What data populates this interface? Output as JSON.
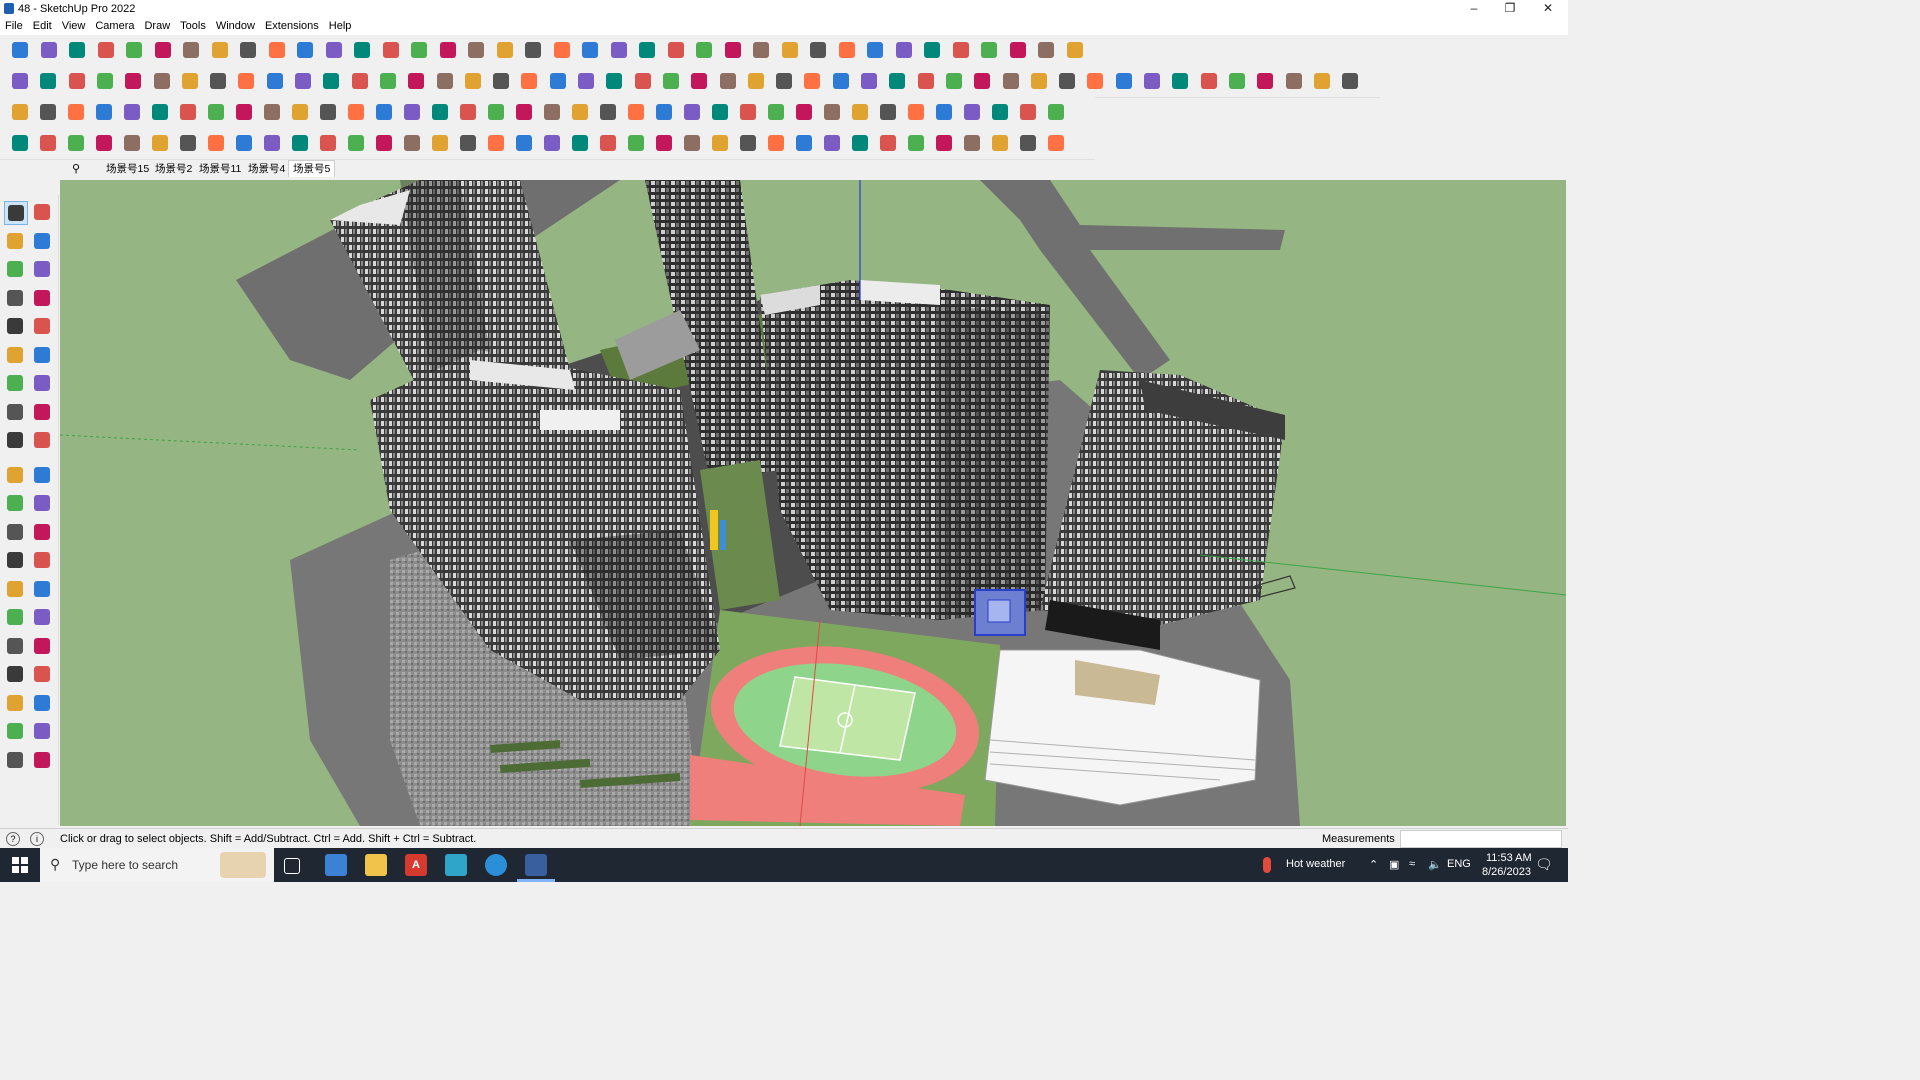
{
  "window": {
    "title": "48 - SketchUp Pro 2022",
    "minimize_icon": "minimize-icon",
    "maximize_icon": "restore-icon",
    "close_icon": "close-icon"
  },
  "menu": {
    "items": [
      "File",
      "Edit",
      "View",
      "Camera",
      "Draw",
      "Tools",
      "Window",
      "Extensions",
      "Help"
    ]
  },
  "scenes": {
    "tabs": [
      "场景号15",
      "场景号2",
      "场景号11",
      "场景号4",
      "场景号5"
    ],
    "active_index": 4,
    "search_icon": "search-icon"
  },
  "statusbar": {
    "hint": "Click or drag to select objects. Shift = Add/Subtract. Ctrl = Add. Shift + Ctrl = Subtract.",
    "measurements_label": "Measurements",
    "measurements_value": ""
  },
  "taskbar": {
    "search_placeholder": "Type here to search",
    "weather": "Hot weather",
    "language": "ENG",
    "time": "11:53 AM",
    "date": "8/26/2023"
  },
  "colors": {
    "ground": "#95b582",
    "road": "#7d7d7d",
    "track": "#ee7f7a",
    "field": "#8ed58b",
    "taskbar": "#1f2733"
  }
}
